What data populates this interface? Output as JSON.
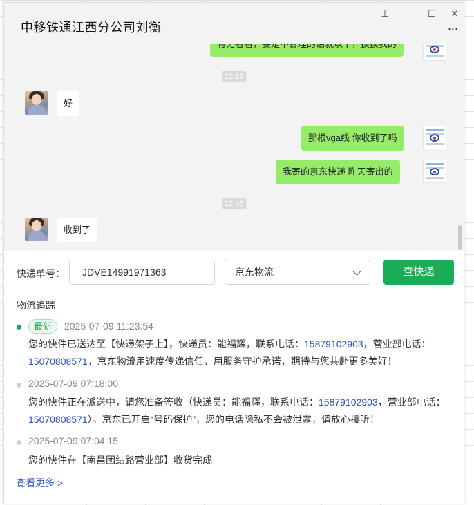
{
  "window": {
    "title": "中移铁通江西分公司刘衡",
    "controls": {
      "pin": "⊥",
      "minimize": "—",
      "maximize": "☐",
      "close": "✕",
      "more": "···"
    }
  },
  "chat": {
    "partial_top_message": "有无者看，要是不合理的话就以下，摸摸我的",
    "messages": [
      {
        "type": "time",
        "text": "12:19"
      },
      {
        "type": "left",
        "text": "好"
      },
      {
        "type": "right",
        "text": "那根vga线 你收到了吗"
      },
      {
        "type": "right",
        "text": "我寄的京东快递  昨天寄出的"
      },
      {
        "type": "time",
        "text": "12:45"
      },
      {
        "type": "left",
        "text": "收到了"
      }
    ]
  },
  "express": {
    "number_label": "快递单号：",
    "number_value": "JDVE14991971363",
    "carrier": "京东物流",
    "query_button": "查快递",
    "tracking_title": "物流追踪",
    "latest_badge": "最新",
    "events": [
      {
        "time": "2025-07-09 11:23:54",
        "text_1": "您的快件已送达至【快递架子上】，快递员：能福辉，联系电话：",
        "phone_1": "15879102903",
        "text_2": "，营业部电话：",
        "phone_2": "15070808571",
        "text_3": "，京东物流用速度传递信任，用服务守护承诺，期待与您共赴更多美好！"
      },
      {
        "time": "2025-07-09 07:18:00",
        "text_1": "您的快件正在派送中，请您准备签收（快递员：能福辉，联系电话：",
        "phone_1": "15879102903",
        "text_2": "，营业部电话：",
        "phone_2": "15070808571",
        "text_3": "）。京东已开启“号码保护”，您的电话隐私不会被泄露，请放心接听！"
      },
      {
        "time": "2025-07-09 07:04:15",
        "text_1": "您的快件在【南昌团结路营业部】收货完成"
      }
    ],
    "see_more": "查看更多 >"
  },
  "colors": {
    "accent_green": "#1aad55",
    "bubble_green": "#95ec69",
    "link_blue": "#2b52c7"
  }
}
